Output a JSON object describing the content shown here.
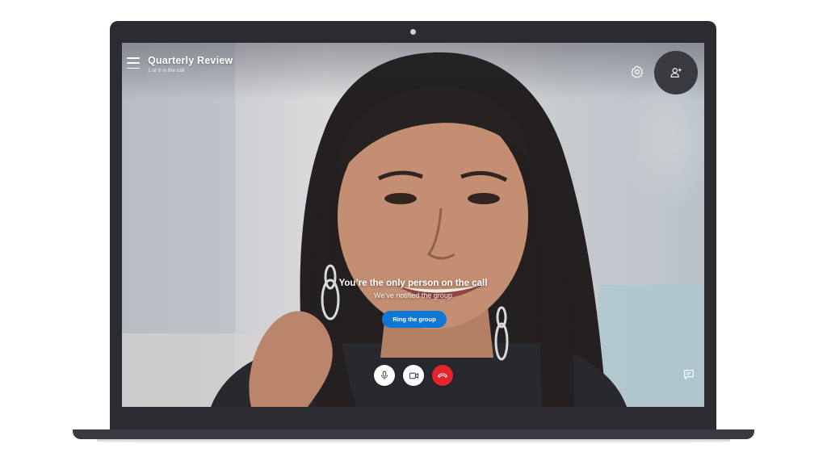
{
  "call": {
    "title": "Quarterly Review",
    "subtitle": "1 of 9 in the call"
  },
  "status": {
    "message": "You’re the only person on the call",
    "sub_message": "We’ve notified the group"
  },
  "actions": {
    "ring_label": "Ring the group"
  },
  "controls": [
    "microphone-icon",
    "video-camera-icon",
    "hang-up-icon"
  ],
  "toolbar_icons": [
    "menu-icon",
    "gear-icon",
    "add-person-icon",
    "chat-icon"
  ],
  "colors": {
    "accent": "#0f78d4",
    "hangup": "#e3262b",
    "bezel": "#2b2b31"
  }
}
